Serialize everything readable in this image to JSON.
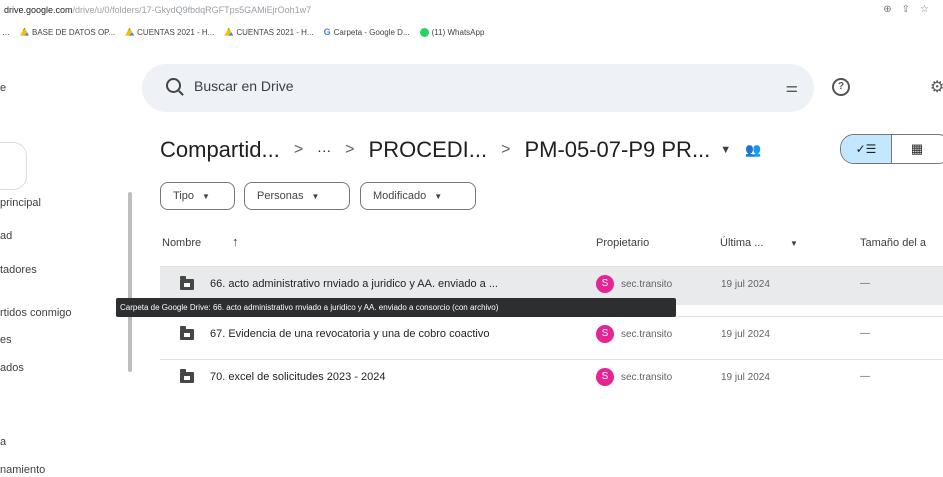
{
  "browser": {
    "url_host": "drive.google.com",
    "url_path": "/drive/u/0/folders/17-GkydQ9fbdqRGFTps5GAMiEjrOoh1w7",
    "icons": [
      "zoom-icon",
      "share-icon",
      "star-icon"
    ]
  },
  "bookmarks": [
    {
      "label": "…",
      "icon": "none"
    },
    {
      "label": "BASE DE DATOS OP...",
      "icon": "drive-icon"
    },
    {
      "label": "CUENTAS 2021 - H...",
      "icon": "drive-icon"
    },
    {
      "label": "CUENTAS 2021 - H...",
      "icon": "drive-icon"
    },
    {
      "label": "Carpeta - Google D...",
      "icon": "google-icon"
    },
    {
      "label": "(11) WhatsApp",
      "icon": "whatsapp-icon"
    }
  ],
  "sidebar": {
    "items": [
      "principal",
      "ad",
      "tadores",
      "rtidos conmigo",
      "es",
      "ados",
      "a",
      "namiento"
    ]
  },
  "search": {
    "placeholder": "Buscar en Drive"
  },
  "breadcrumb": {
    "root": "Compartid...",
    "ellipsis": "···",
    "parent": "PROCEDI...",
    "current": "PM-05-07-P9 PR..."
  },
  "filters": {
    "type": "Tipo",
    "people": "Personas",
    "modified": "Modificado"
  },
  "table": {
    "columns": {
      "name": "Nombre",
      "sort_arrow": "↑",
      "owner": "Propietario",
      "modified": "Última ...",
      "size": "Tamaño del a"
    },
    "rows": [
      {
        "name": "66. acto administrativo rnviado a juridico y AA. enviado a ...",
        "owner_initial": "S",
        "owner": "sec.transito",
        "date": "19 jul 2024",
        "size": "—"
      },
      {
        "name": "67. Evidencia de una revocatoria y una de cobro coactivo",
        "owner_initial": "S",
        "owner": "sec.transito",
        "date": "19 jul 2024",
        "size": "—"
      },
      {
        "name": "70. excel de solicitudes 2023 - 2024",
        "owner_initial": "S",
        "owner": "sec.transito",
        "date": "19 jul 2024",
        "size": "—"
      }
    ]
  },
  "tooltip": {
    "text": "Carpeta de Google Drive: 66. acto administrativo rnviado a juridico y AA. enviado a consorcio (con archivo)"
  },
  "colors": {
    "accent_selected": "#c2e7ff",
    "avatar": "#e52592",
    "search_bg": "#eef1f6"
  }
}
